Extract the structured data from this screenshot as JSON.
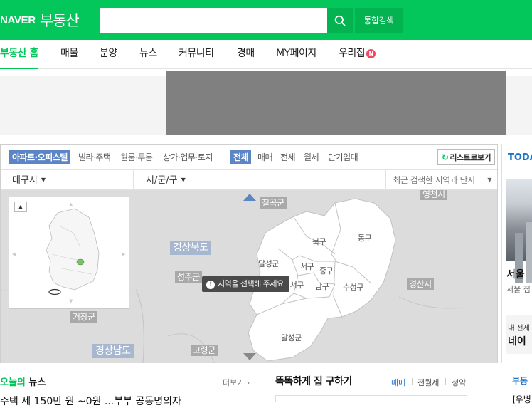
{
  "header": {
    "logo_naver": "NAVER",
    "logo_service": "부동산",
    "search_value": "",
    "search_placeholder": "",
    "search_icon": "search-icon",
    "total_search_label": "통합검색"
  },
  "nav": {
    "items": [
      {
        "label": "부동산 홈",
        "active": true
      },
      {
        "label": "매물"
      },
      {
        "label": "분양"
      },
      {
        "label": "뉴스"
      },
      {
        "label": "커뮤니티"
      },
      {
        "label": "경매"
      },
      {
        "label": "MY페이지"
      },
      {
        "label": "우리집"
      }
    ],
    "new_badge": "N"
  },
  "map": {
    "filter_tabs": [
      "아파트·오피스텔",
      "빌라·주택",
      "원룸·투룸",
      "상가·업무·토지"
    ],
    "deal_tabs": [
      "전체",
      "매매",
      "전세",
      "월세",
      "단기임대"
    ],
    "list_button": "리스트로보기",
    "list_icon": "refresh-icon",
    "region_city": "대구시",
    "region_district": "시/군/구",
    "recent_search": "최근 검색한 지역과 단지",
    "regions_big": [
      "경상북도",
      "경상남도"
    ],
    "regions_gray": [
      "칠곡군",
      "영천시",
      "성주군",
      "경산시",
      "거창군",
      "고령군"
    ],
    "districts": [
      "북구",
      "동구",
      "달성군",
      "서구",
      "중구",
      "남구",
      "수성구",
      "달서구",
      "달성군"
    ],
    "tooltip": "지역을 선택해 주세요",
    "tooltip_icon": "exclamation-icon",
    "minimap_toggle_icon": "chevron-up-icon",
    "colors": {
      "accent": "#03c75a",
      "tab_active": "#5b85c5",
      "region_shape": "#ffffff",
      "map_bg": "#dcdcdc"
    }
  },
  "right": {
    "today_title": "TODA",
    "headline": "서울 ",
    "subline": "서울 집",
    "card_line1": "내 전세",
    "card_line2": "네이"
  },
  "bottom": {
    "news_title_green": "오늘의",
    "news_title_rest": " 뉴스",
    "more_label": "더보기",
    "headline": "주택 세 150만 원 ~0원 ...부부 공동명의자",
    "house_title": "똑똑하게 집 구하기",
    "house_tabs": [
      "매매",
      "전월세",
      "청약"
    ],
    "right_title": "부동",
    "right_sub": "[우병"
  }
}
